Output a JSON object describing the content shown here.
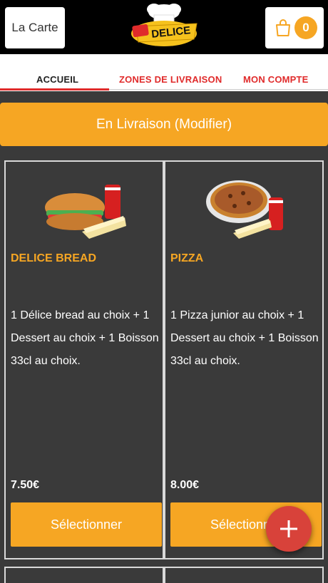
{
  "header": {
    "menu_label": "La Carte",
    "logo_text": "DELICE",
    "cart_count": "0"
  },
  "tabs": [
    {
      "label": "ACCUEIL"
    },
    {
      "label": "ZONES DE LIVRAISON"
    },
    {
      "label": "MON COMPTE"
    }
  ],
  "delivery_label": "En Livraison (Modifier)",
  "products": [
    {
      "title": "DELICE BREAD",
      "description": "1 Délice bread au choix  + 1 Dessert au choix  + 1 Boisson 33cl au choix.",
      "price": "7.50€",
      "button": "Sélectionner"
    },
    {
      "title": "PIZZA",
      "description": "1 Pizza junior au choix  + 1 Dessert au choix  + 1 Boisson 33cl au choix.",
      "price": "8.00€",
      "button": "Sélectionner"
    }
  ],
  "colors": {
    "accent": "#f6a623",
    "tab_active": "#e02b2b",
    "background": "#3a3a3a",
    "fab": "#d8423a"
  },
  "icons": {
    "cart": "shopping-bag-icon",
    "fab": "plus-icon"
  }
}
